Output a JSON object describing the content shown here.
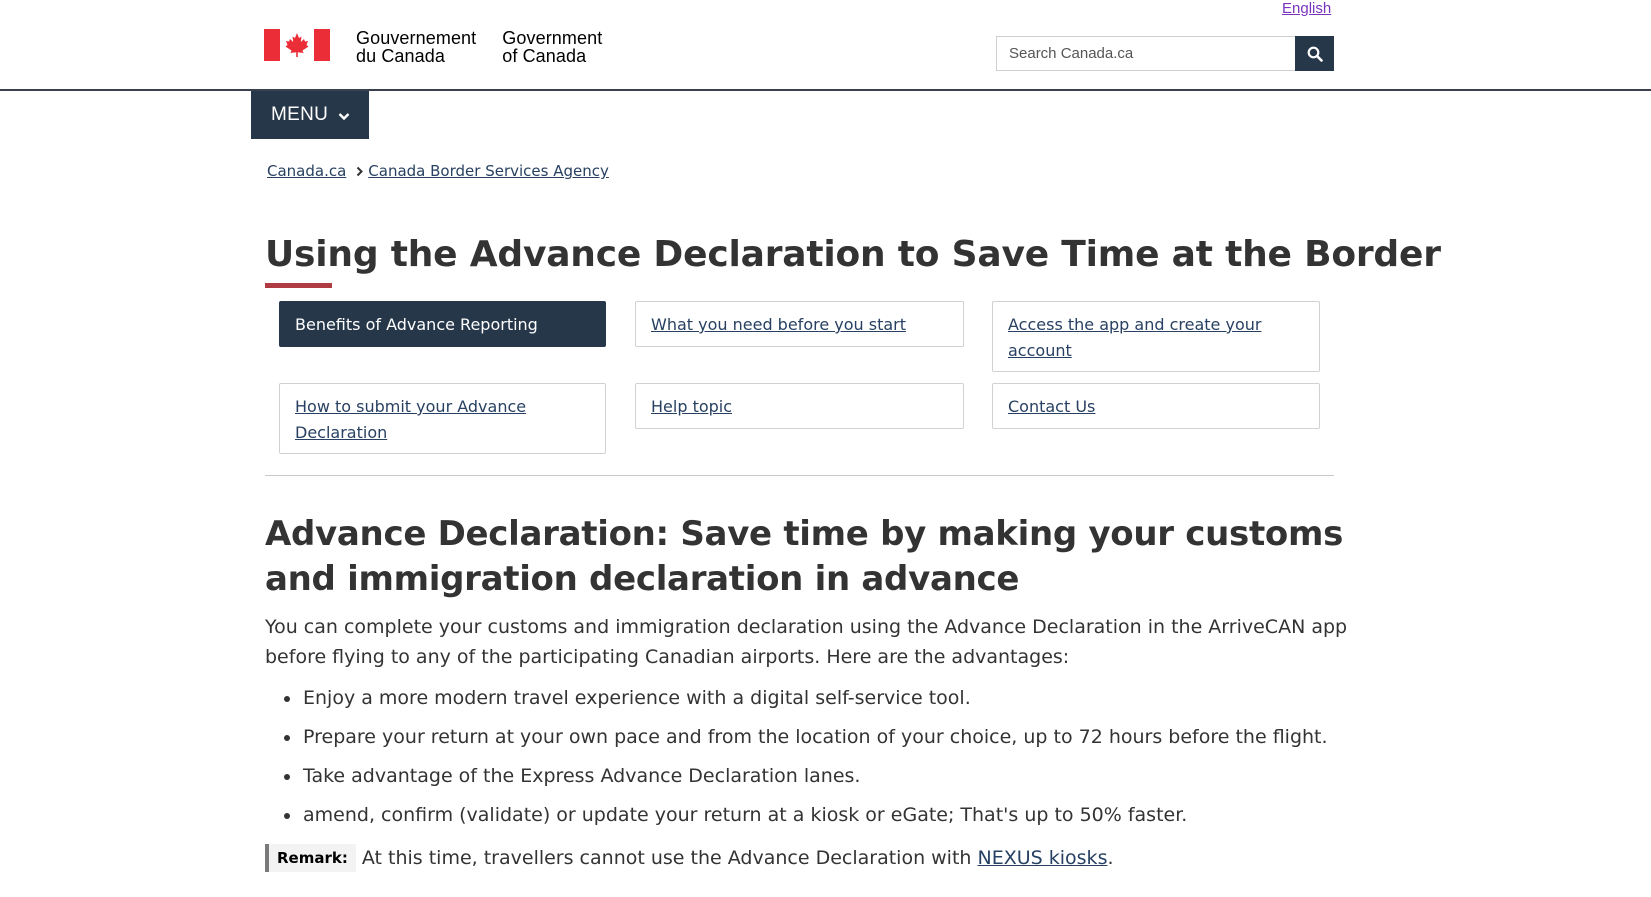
{
  "header": {
    "language_link": "English",
    "gov_fr_line1": "Gouvernement",
    "gov_fr_line2": "du Canada",
    "gov_en_line1": "Government",
    "gov_en_line2": "of Canada",
    "search_placeholder": "Search Canada.ca",
    "flag_red": "#eb2d37"
  },
  "menu": {
    "label": "MENU"
  },
  "breadcrumb": [
    {
      "label": "Canada.ca"
    },
    {
      "label": "Canada Border Services Agency"
    }
  ],
  "page": {
    "title": "Using the Advance Declaration to Save Time at the Border"
  },
  "nav": {
    "items": [
      {
        "label": "Benefits of Advance Reporting",
        "active": true
      },
      {
        "label": "What you need before you start",
        "active": false
      },
      {
        "label": "Access the app and create your account",
        "active": false
      },
      {
        "label": "How to submit your Advance Declaration",
        "active": false
      },
      {
        "label": "Help topic",
        "active": false
      },
      {
        "label": "Contact Us",
        "active": false
      }
    ]
  },
  "section": {
    "heading": "Advance Declaration: Save time by making your customs and immigration declaration in advance",
    "intro": "You can complete your customs and immigration declaration using the Advance Declaration in the ArriveCAN app before flying to any of the participating Canadian airports. Here are the advantages:",
    "advantages": [
      "Enjoy a more modern travel experience with a digital self-service tool.",
      "Prepare your return at your own pace and from the location of your choice, up to 72 hours before the flight.",
      "Take advantage of the Express Advance Declaration lanes.",
      "amend, confirm (validate) or update your return at a kiosk or eGate; That's up to 50% faster."
    ],
    "remark_label": "Remark:",
    "remark_text": "At this time, travellers cannot use the Advance Declaration with",
    "remark_link": "NEXUS kiosks",
    "remark_end": "."
  },
  "colors": {
    "primary": "#26374a",
    "link": "#284162",
    "visited_link": "#7834bc",
    "accent": "#af3c43"
  }
}
